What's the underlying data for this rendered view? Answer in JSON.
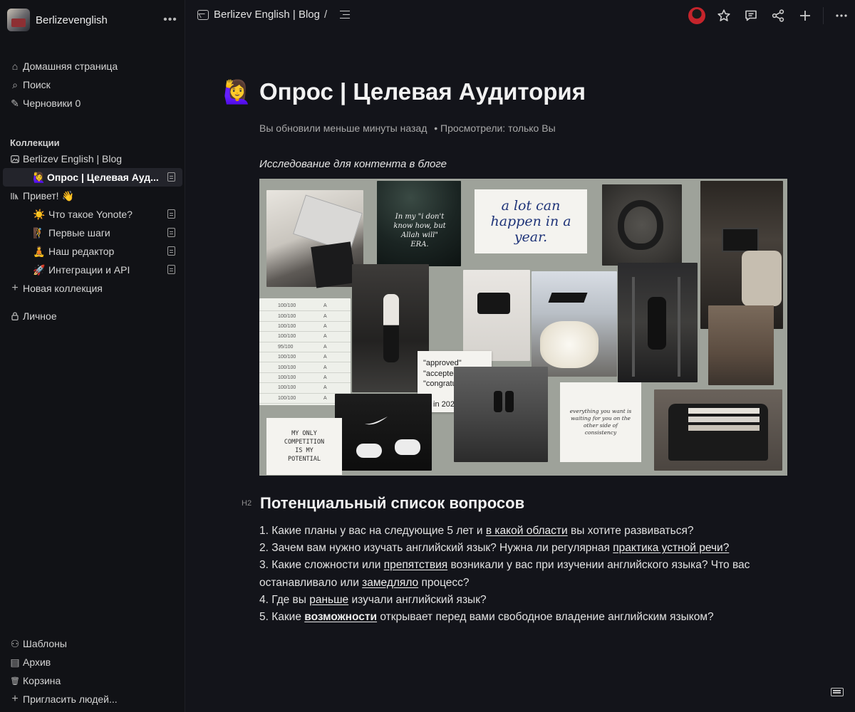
{
  "workspace": {
    "name": "Berlizevenglish",
    "more": "•••"
  },
  "nav_top": [
    {
      "label": "Домашняя страница",
      "icon": "home-icon",
      "glyph": "⌂"
    },
    {
      "label": "Поиск",
      "icon": "search-icon",
      "glyph": "⌕"
    },
    {
      "label": "Черновики 0",
      "icon": "pencil-icon",
      "glyph": "✎"
    }
  ],
  "collections_label": "Коллекции",
  "collections": {
    "blog": {
      "label": "Berlizev English | Blog",
      "icon": "image-icon"
    },
    "active_doc": {
      "emoji": "🙋‍♀️",
      "label": "Опрос | Целевая Ауд..."
    },
    "hello": {
      "label": "Привет! 👋",
      "icon": "library-icon"
    },
    "children": [
      {
        "emoji": "☀️",
        "label": "Что такое Yonote?"
      },
      {
        "emoji": "🧗",
        "label": "Первые шаги"
      },
      {
        "emoji": "🧘",
        "label": "Наш редактор"
      },
      {
        "emoji": "🚀",
        "label": "Интеграции и API"
      }
    ],
    "new_collection": "Новая коллекция"
  },
  "personal": "Личное",
  "nav_bottom": [
    {
      "label": "Шаблоны",
      "icon": "templates-icon",
      "glyph": "⚇"
    },
    {
      "label": "Архив",
      "icon": "archive-icon",
      "glyph": "▤"
    },
    {
      "label": "Корзина",
      "icon": "trash-icon",
      "glyph": "🗑"
    },
    {
      "label": "Пригласить людей...",
      "icon": "plus-icon",
      "glyph": "+"
    }
  ],
  "breadcrumb": {
    "collection": "Berlizev English | Blog",
    "slash": "/"
  },
  "toolbar": {
    "star": "☆",
    "comment": "💬",
    "share": "⤴",
    "add": "+",
    "more": "⋯"
  },
  "doc": {
    "emoji": "🙋‍♀️",
    "title": "Опрос | Целевая Аудитория",
    "meta_updated": "Вы обновили меньше минуты назад",
    "meta_viewed": "• Просмотрели: только Вы",
    "caption": "Исследование для контента в блоге",
    "collage": {
      "note_year": "a lot can happen in a year.",
      "note_allah": "In my \"i don't know how, but Allah will\" ERA.",
      "note_approved": [
        "\"approved\"",
        "\"accepted\"",
        "\"congratulations\"",
        "all in 2024."
      ],
      "note_consistency": "everything you want is waiting for you on the other side of consistency",
      "note_competition": "MY ONLY COMPETITION IS MY POTENTIAL",
      "grades": [
        "100/100",
        "100/100",
        "100/100",
        "100/100",
        "95/100",
        "100/100",
        "100/100",
        "100/100",
        "100/100",
        "100/100"
      ],
      "grade_letter": "A"
    },
    "h2_tag": "H2",
    "h2": "Потенциальный список вопросов",
    "q1": {
      "a": "1. Какие планы у вас на следующие 5 лет и ",
      "link": "в какой области",
      "b": " вы хотите развиваться?"
    },
    "q2": {
      "a": "2. Зачем вам нужно изучать английский язык? Нужна ли регулярная  ",
      "link": "практика устной речи?"
    },
    "q3": {
      "a": "3. Какие сложности или ",
      "link1": "препятствия",
      "b": " возникали у вас при изучении английского языка? Что вас останавливало или ",
      "link2": "замедляло",
      "c": " процесс?"
    },
    "q4": {
      "a": "4. Где вы ",
      "link": "раньше",
      "b": " изучали английский язык?"
    },
    "q5": {
      "a": "5. Какие ",
      "link": "возможности",
      "b": " открывает перед вами свободное владение английским языком?"
    }
  }
}
